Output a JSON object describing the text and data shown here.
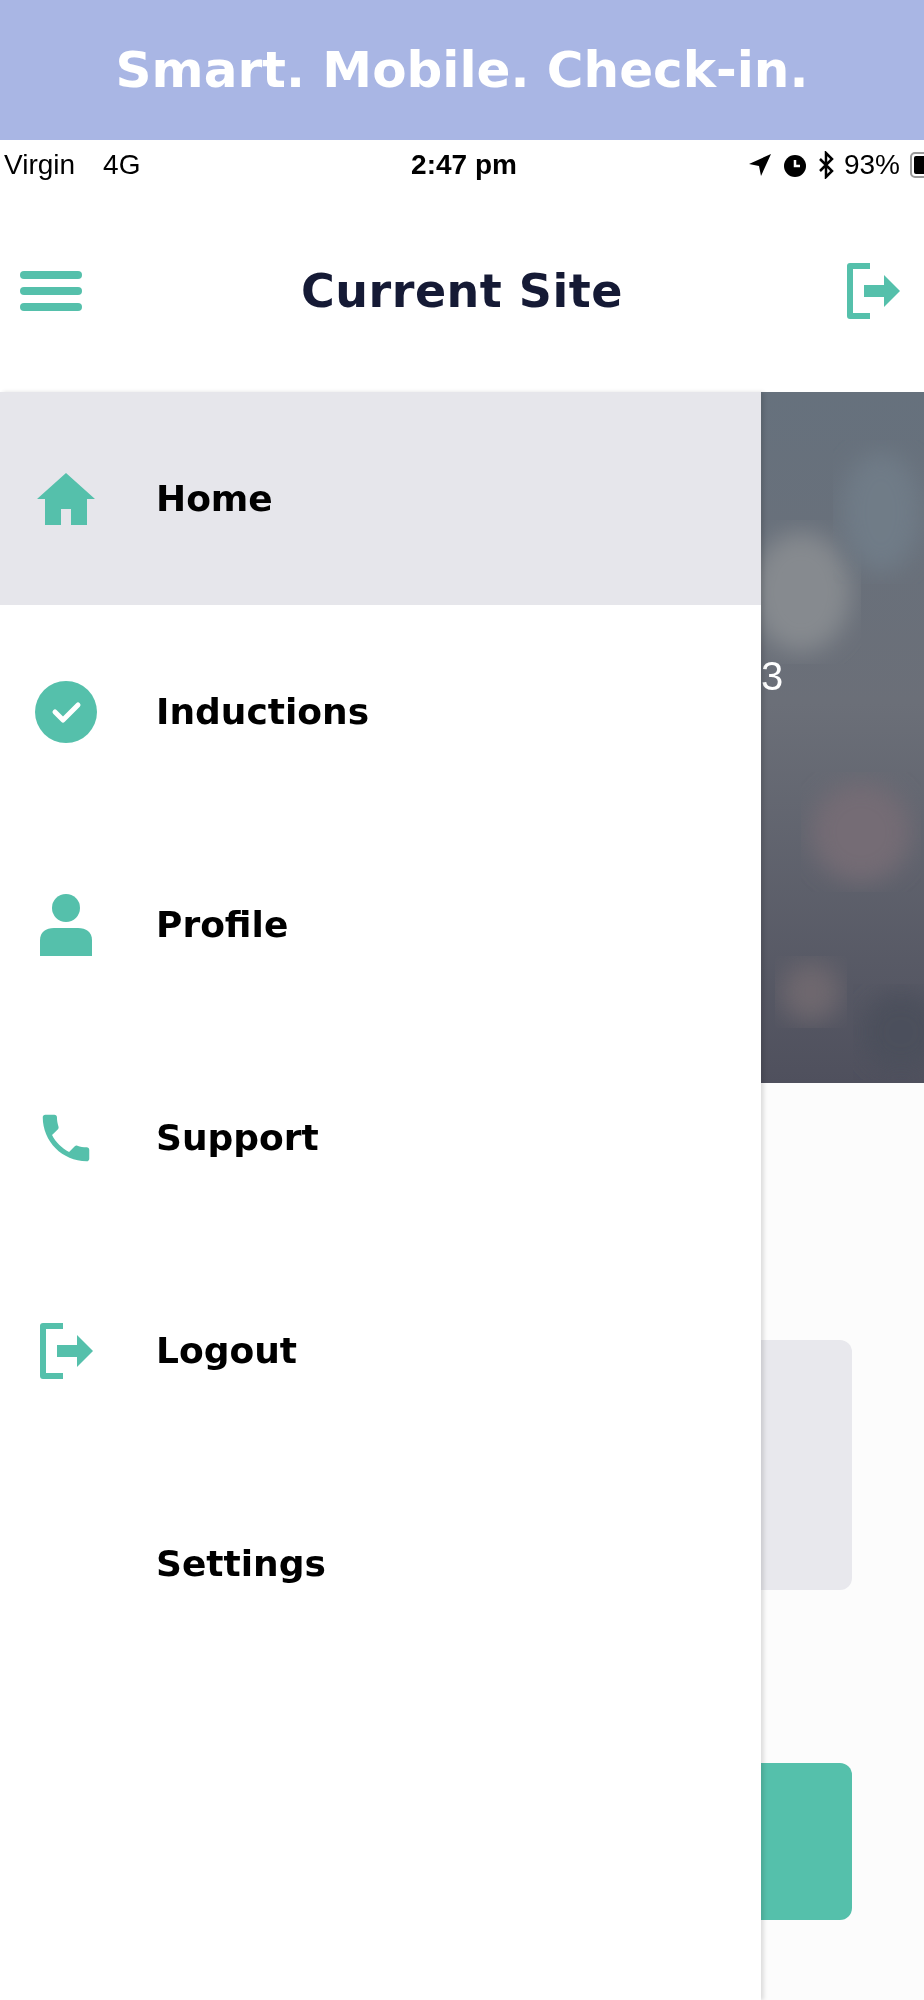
{
  "banner": {
    "title": "Smart. Mobile. Check-in."
  },
  "status_bar": {
    "carrier": "Virgin",
    "network": "4G",
    "time": "2:47 pm",
    "battery": "93%"
  },
  "header": {
    "title": "Current Site"
  },
  "menu": [
    {
      "label": "Home",
      "kind": "home",
      "selected": true
    },
    {
      "label": "Inductions",
      "kind": "inductions",
      "selected": false
    },
    {
      "label": "Profile",
      "kind": "profile",
      "selected": false
    },
    {
      "label": "Support",
      "kind": "support",
      "selected": false
    },
    {
      "label": "Logout",
      "kind": "logout",
      "selected": false
    },
    {
      "label": "Settings",
      "kind": "settings",
      "selected": false
    }
  ],
  "background": {
    "picture_text": "3"
  }
}
